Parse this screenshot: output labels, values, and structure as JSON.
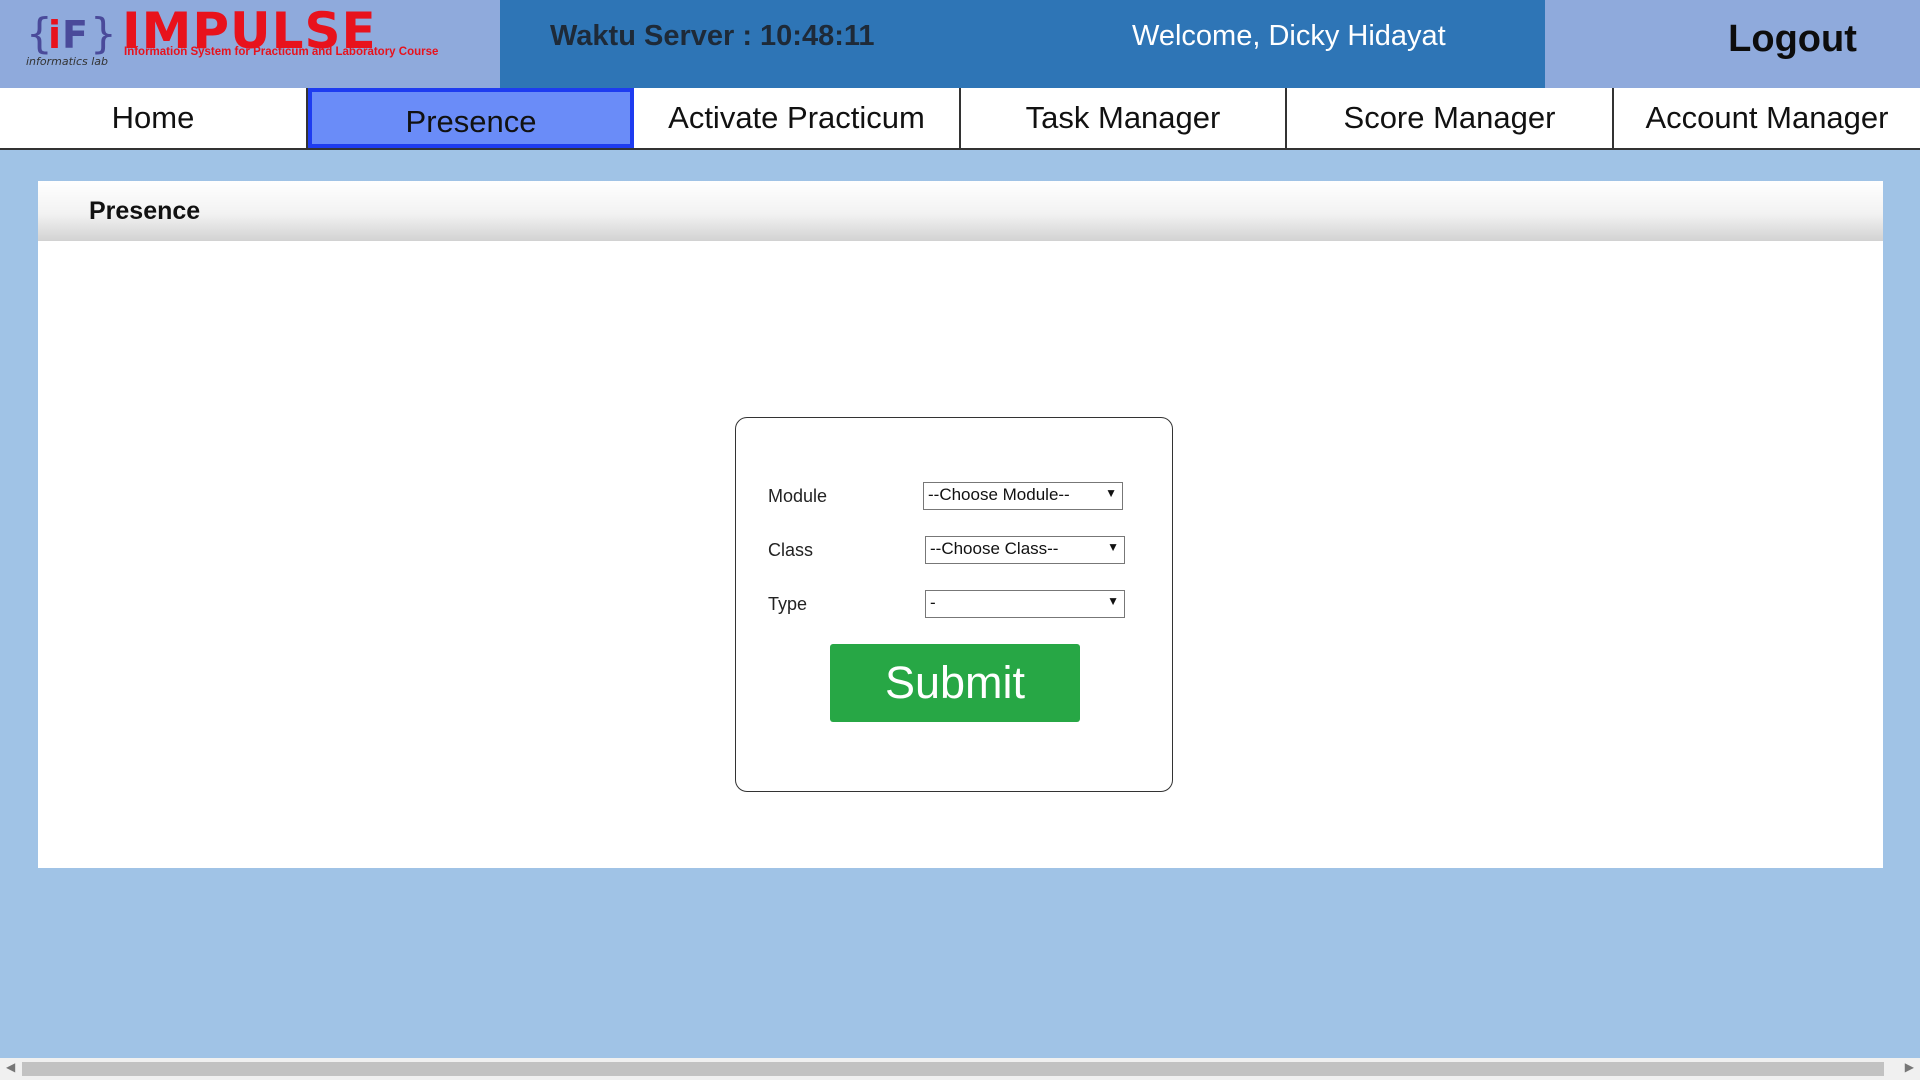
{
  "header": {
    "logo": {
      "name": "IMPULSE",
      "tagline": "Information System for Practicum and Laboratory Course",
      "lab_text": "informatics lab",
      "brand_color": "#e8121c"
    },
    "server_time": "Waktu Server : 10:48:11",
    "welcome": "Welcome, Dicky Hidayat",
    "logout_label": "Logout"
  },
  "nav": {
    "items": [
      {
        "label": "Home"
      },
      {
        "label": "Presence"
      },
      {
        "label": "Activate Practicum"
      },
      {
        "label": "Task Manager"
      },
      {
        "label": "Score Manager"
      },
      {
        "label": "Account Manager"
      }
    ],
    "active": "Presence"
  },
  "panel": {
    "title": "Presence"
  },
  "form": {
    "module": {
      "label": "Module",
      "value": "--Choose Module--"
    },
    "class": {
      "label": "Class",
      "value": "--Choose Class--"
    },
    "type": {
      "label": "Type",
      "value": "-"
    },
    "submit_label": "Submit",
    "submit_color": "#27a745"
  },
  "colors": {
    "background": "#a0c3e6",
    "header_bar": "#2e75b6",
    "header_side": "#8faadc",
    "nav_active": "#6a8cf8"
  }
}
